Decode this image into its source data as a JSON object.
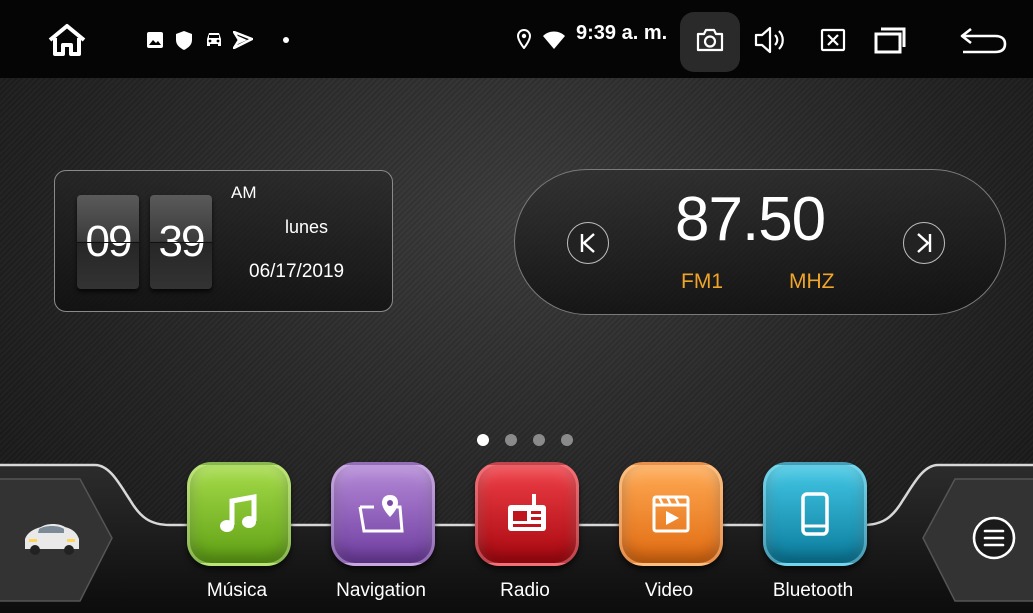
{
  "status_bar": {
    "time": "9:39 a. m.",
    "icons": [
      "home-icon",
      "image-icon",
      "shield-icon",
      "car-icon",
      "location-arrow-icon",
      "dot-icon",
      "location-pin-icon",
      "wifi-icon",
      "camera-icon",
      "volume-icon",
      "close-box-icon",
      "recent-apps-icon",
      "back-icon"
    ]
  },
  "clock": {
    "hour": "09",
    "minute": "39",
    "ampm": "AM",
    "weekday": "lunes",
    "date": "06/17/2019"
  },
  "radio": {
    "frequency": "87.50",
    "band": "FM1",
    "unit": "MHZ",
    "accent_color": "#f0a52a"
  },
  "pager": {
    "count": 4,
    "active": 0
  },
  "dock": {
    "apps": [
      {
        "label": "Música",
        "icon": "music-note-icon",
        "color": "#7dbb2a"
      },
      {
        "label": "Navigation",
        "icon": "map-pin-icon",
        "color": "#8a52b8"
      },
      {
        "label": "Radio",
        "icon": "radio-icon",
        "color": "#cc1820"
      },
      {
        "label": "Video",
        "icon": "video-icon",
        "color": "#ee8424"
      },
      {
        "label": "Bluetooth",
        "icon": "phone-icon",
        "color": "#1ea3c4"
      }
    ],
    "left_button_icon": "car-icon",
    "right_button_icon": "menu-icon"
  }
}
